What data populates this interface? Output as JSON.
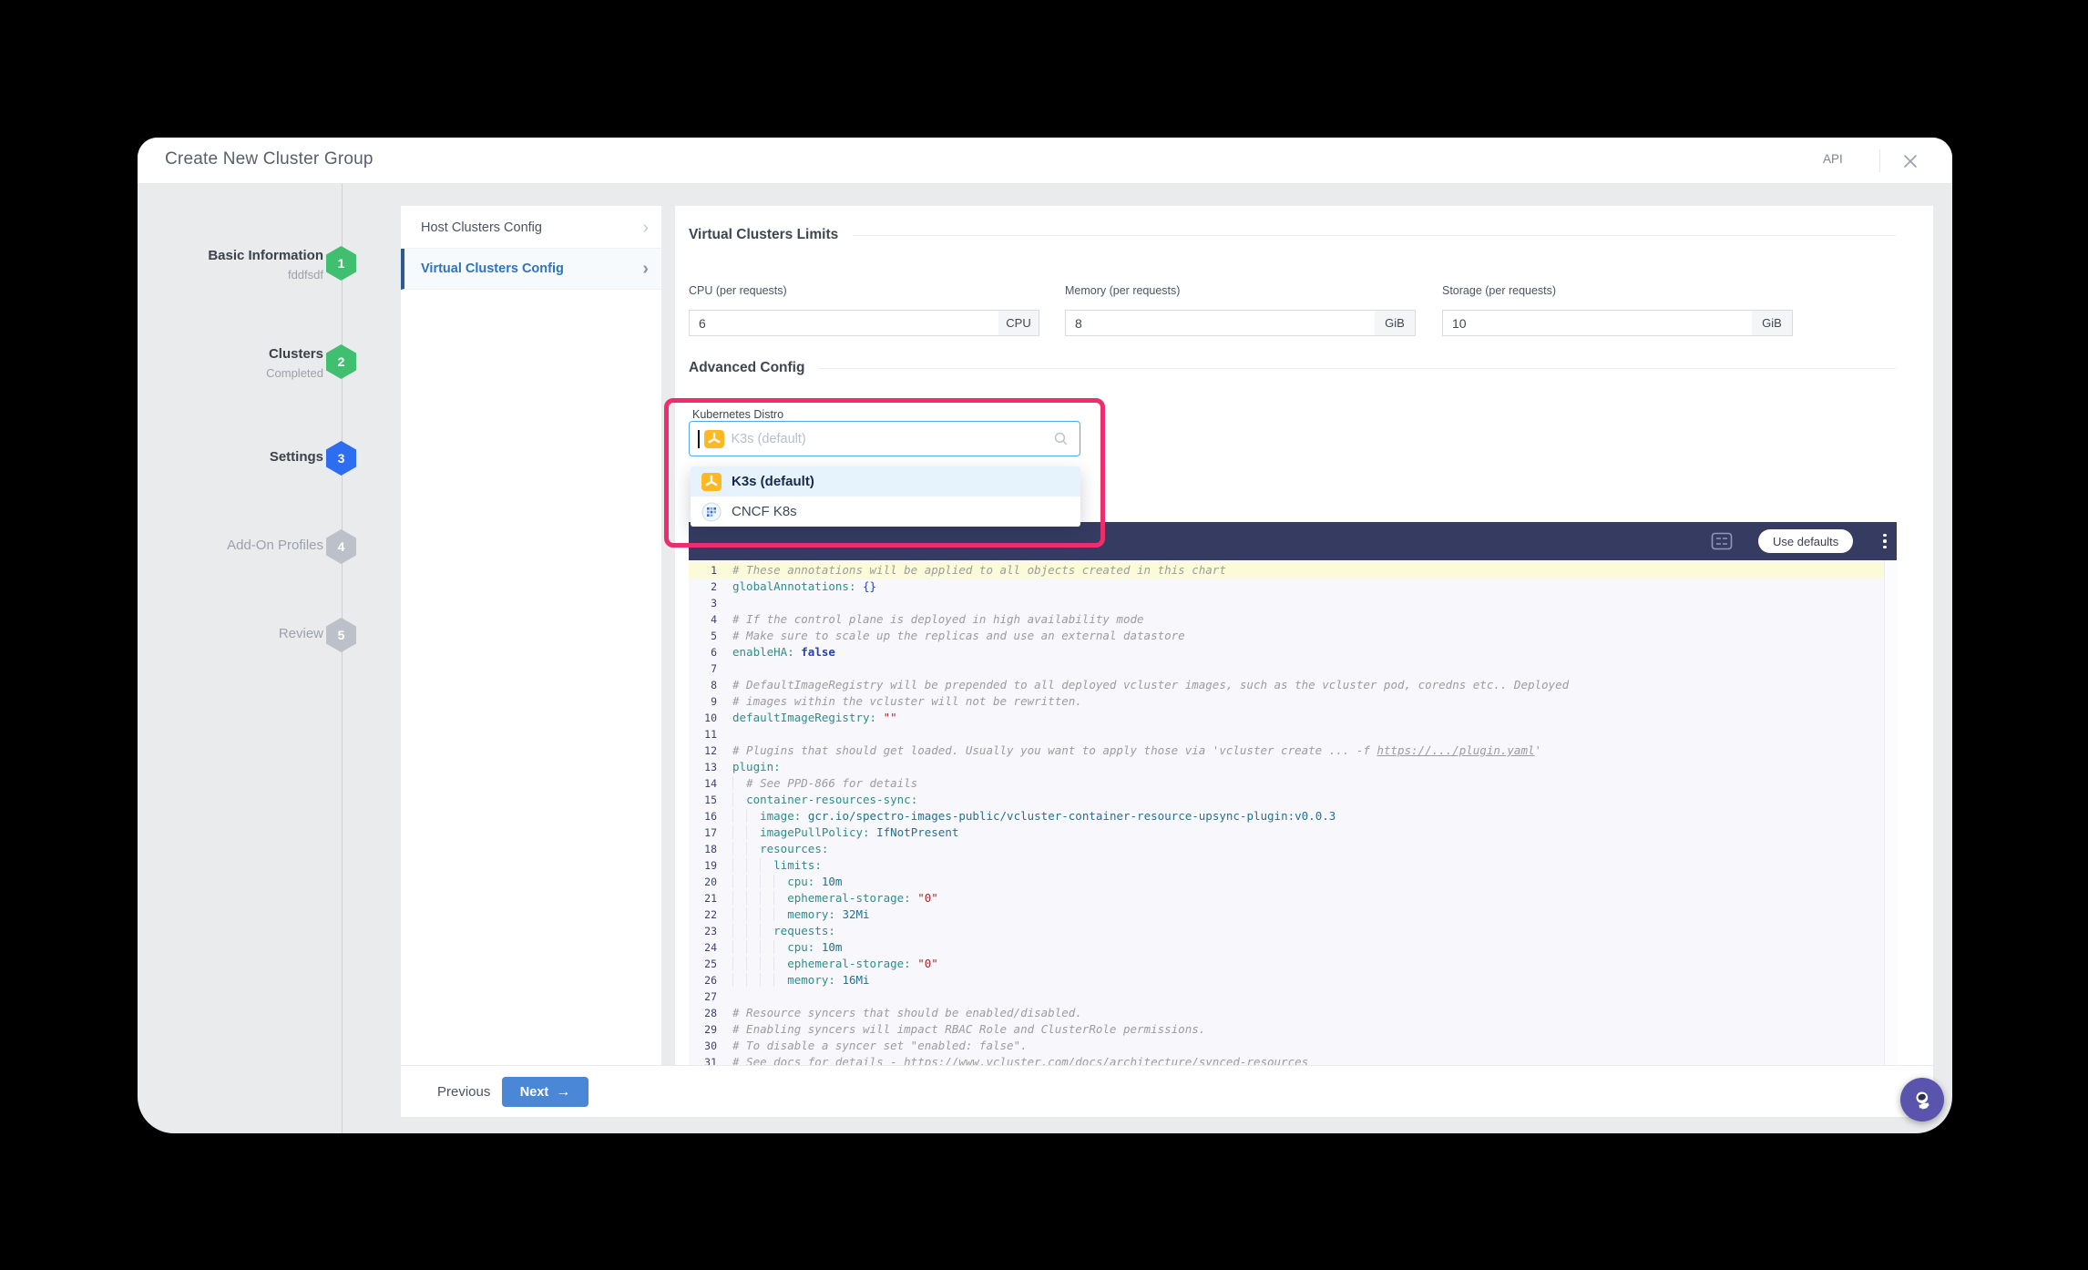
{
  "window": {
    "title": "Create New Cluster Group",
    "api_label": "API"
  },
  "steps": [
    {
      "num": "1",
      "label": "Basic Information",
      "sublabel": "fddfsdf",
      "state": "done"
    },
    {
      "num": "2",
      "label": "Clusters",
      "sublabel": "Completed",
      "state": "done"
    },
    {
      "num": "3",
      "label": "Settings",
      "sublabel": "",
      "state": "active"
    },
    {
      "num": "4",
      "label": "Add-On Profiles",
      "sublabel": "",
      "state": "todo"
    },
    {
      "num": "5",
      "label": "Review",
      "sublabel": "",
      "state": "todo"
    }
  ],
  "subnav": {
    "items": [
      {
        "label": "Host Clusters Config",
        "active": false
      },
      {
        "label": "Virtual Clusters Config",
        "active": true
      }
    ]
  },
  "limits": {
    "heading": "Virtual Clusters Limits",
    "fields": [
      {
        "label": "CPU (per requests)",
        "value": "6",
        "unit": "CPU"
      },
      {
        "label": "Memory (per requests)",
        "value": "8",
        "unit": "GiB"
      },
      {
        "label": "Storage (per requests)",
        "value": "10",
        "unit": "GiB"
      }
    ]
  },
  "advanced": {
    "heading": "Advanced Config",
    "distro_label": "Kubernetes Distro",
    "search_placeholder": "K3s (default)",
    "options": [
      {
        "label": "K3s (default)",
        "icon": "k3s-icon",
        "selected": true
      },
      {
        "label": "CNCF K8s",
        "icon": "cncf-icon",
        "selected": false
      }
    ]
  },
  "editor": {
    "use_defaults_label": "Use defaults",
    "lines": [
      "# These annotations will be applied to all objects created in this chart",
      "globalAnnotations: {}",
      "",
      "# If the control plane is deployed in high availability mode",
      "# Make sure to scale up the replicas and use an external datastore",
      "enableHA: false",
      "",
      "# DefaultImageRegistry will be prepended to all deployed vcluster images, such as the vcluster pod, coredns etc.. Deployed",
      "# images within the vcluster will not be rewritten.",
      "defaultImageRegistry: \"\"",
      "",
      "# Plugins that should get loaded. Usually you want to apply those via 'vcluster create ... -f https://.../plugin.yaml'",
      "plugin:",
      "  # See PPD-866 for details",
      "  container-resources-sync:",
      "    image: gcr.io/spectro-images-public/vcluster-container-resource-upsync-plugin:v0.0.3",
      "    imagePullPolicy: IfNotPresent",
      "    resources:",
      "      limits:",
      "        cpu: 10m",
      "        ephemeral-storage: \"0\"",
      "        memory: 32Mi",
      "      requests:",
      "        cpu: 10m",
      "        ephemeral-storage: \"0\"",
      "        memory: 16Mi",
      "",
      "# Resource syncers that should be enabled/disabled.",
      "# Enabling syncers will impact RBAC Role and ClusterRole permissions.",
      "# To disable a syncer set \"enabled: false\".",
      "# See docs for details - https://www.vcluster.com/docs/architecture/synced-resources"
    ]
  },
  "footer": {
    "previous_label": "Previous",
    "next_label": "Next"
  },
  "colors": {
    "accent_blue": "#2e6cf0",
    "success_green": "#41bf71",
    "inactive_gray": "#bcc1c9",
    "highlight_pink": "#ee2e6c",
    "editor_header_navy": "#363b61",
    "k3s_yellow": "#fdb924",
    "next_button_blue": "#4a87d7",
    "support_purple": "#5a54ad",
    "active_link_blue": "#2d74b8"
  }
}
